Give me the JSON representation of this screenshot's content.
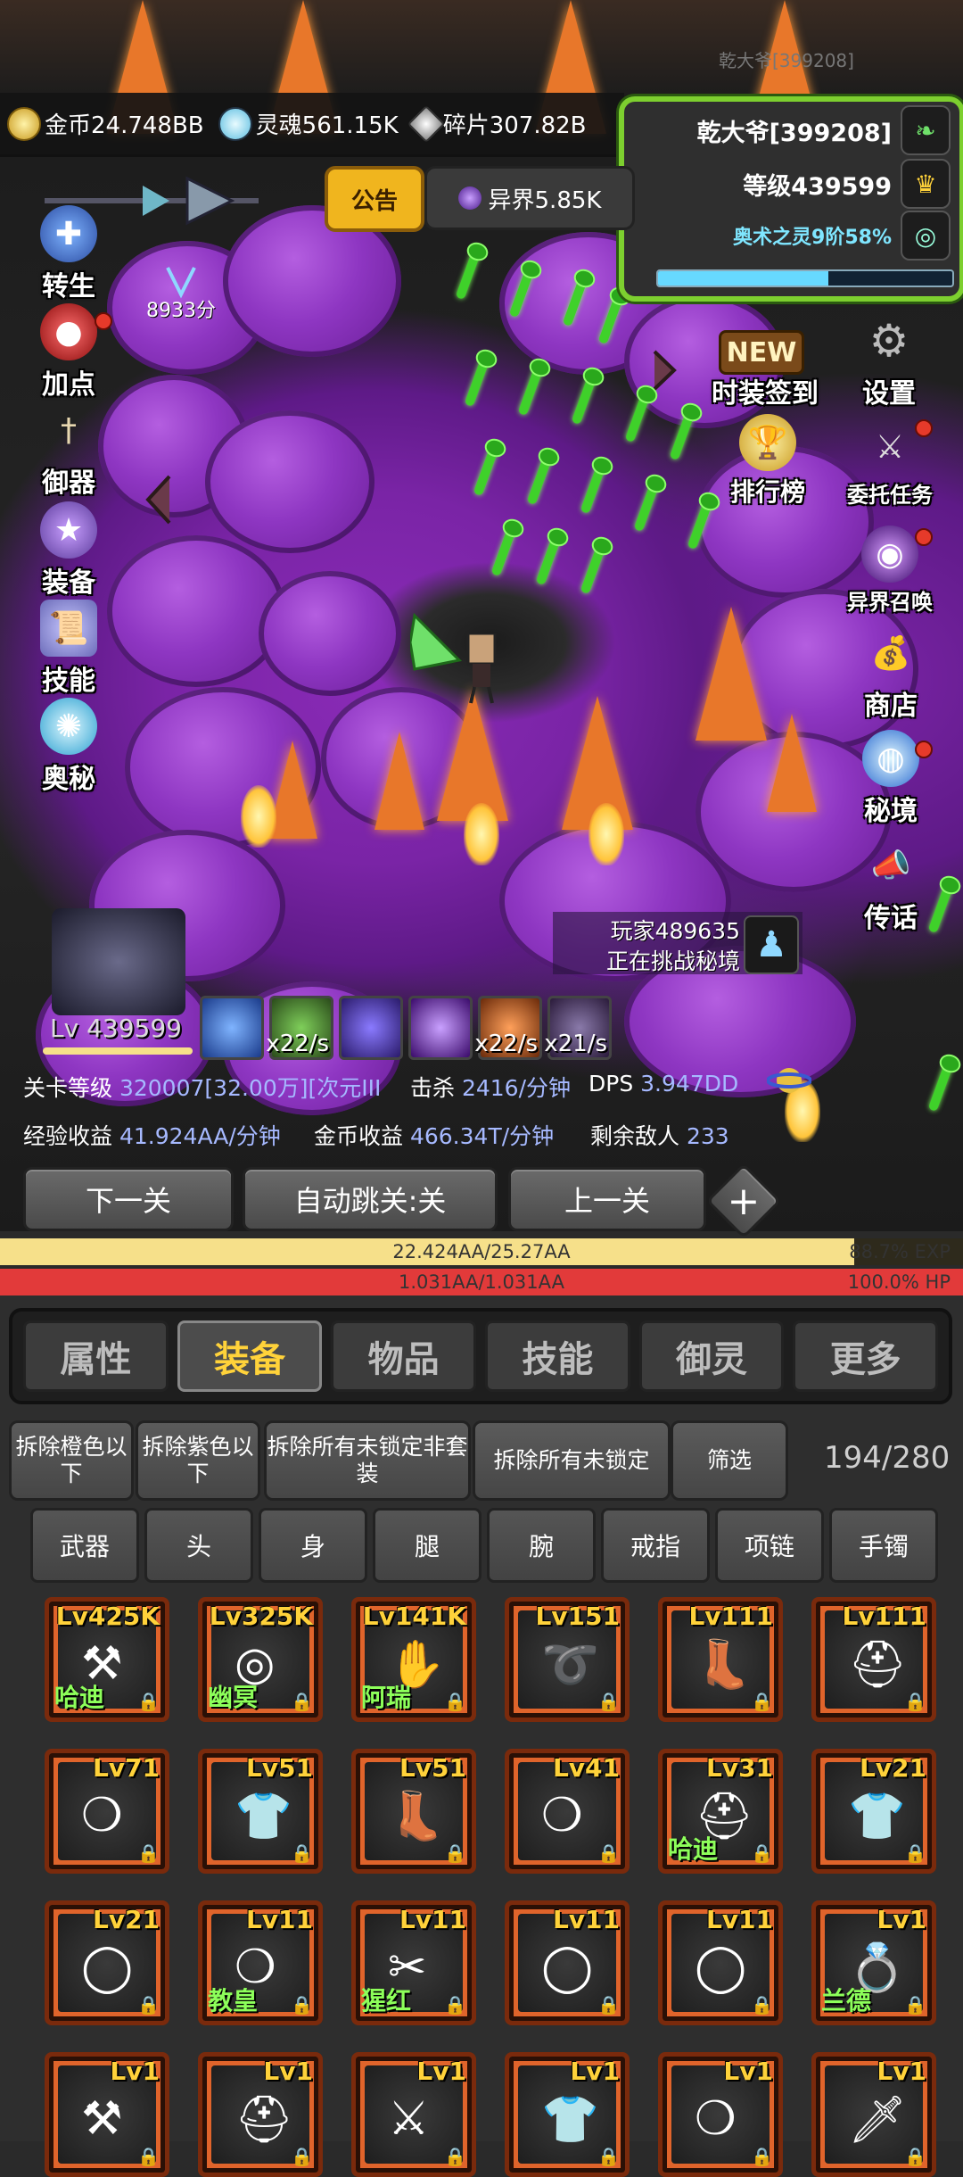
{
  "header": {
    "top_name": "乾大爷[399208]"
  },
  "resources": [
    {
      "label": "金币24.748BB",
      "icon": "gold-coin-icon",
      "color": "#e8c040"
    },
    {
      "label": "灵魂561.15K",
      "icon": "soul-icon",
      "color": "#8fd8ff"
    },
    {
      "label": "碎片307.82B",
      "icon": "shard-icon",
      "color": "#cfcfcf"
    }
  ],
  "player": {
    "name": "乾大爷[399208]",
    "level": "等级439599",
    "arcane": "奥术之灵9阶58%",
    "arcane_progress": 0.58
  },
  "notice": "公告",
  "otherworld": "异界5.85K",
  "score": "8933分",
  "left_menu": [
    "转生",
    "加点",
    "御器",
    "装备",
    "技能",
    "奥秘"
  ],
  "right_menu": {
    "fashion": "时装签到",
    "fashion_badge": "NEW",
    "settings": "设置",
    "ranking": "排行榜",
    "commission": "委托任务",
    "summon": "异界召唤",
    "shop": "商店",
    "secret": "秘境",
    "teleport": "传话"
  },
  "other_player": {
    "line1": "玩家489635",
    "line2": "正在挑战秘境"
  },
  "hero_level": "Lv 439599",
  "skills": [
    {
      "label": "",
      "color": "#2a5ad0"
    },
    {
      "label": "x22/s",
      "color": "#3d6b2a"
    },
    {
      "label": "",
      "color": "#4b2aa8"
    },
    {
      "label": "",
      "color": "#6a2ab8"
    },
    {
      "label": "x22/s",
      "color": "#c0581e"
    },
    {
      "label": "x21/s",
      "color": "#4a3a6a"
    }
  ],
  "stats": {
    "stage_label": "关卡等级",
    "stage_value": "320007[32.00万][次元III",
    "kill_label": "击杀",
    "kill_value": "2416/分钟",
    "dps_label": "DPS",
    "dps_value": "3.947DD",
    "exp_label": "经验收益",
    "exp_value": "41.924AA/分钟",
    "gold_label": "金币收益",
    "gold_value": "466.34T/分钟",
    "enemy_label": "剩余敌人",
    "enemy_value": "233"
  },
  "buttons": {
    "next": "下一关",
    "auto": "自动跳关:关",
    "prev": "上一关",
    "plus": "+"
  },
  "exp_bar": {
    "text": "22.424AA/25.27AA",
    "pct": "88.7% EXP",
    "fraction": 0.887
  },
  "hp_bar": {
    "text": "1.031AA/1.031AA",
    "pct": "100.0% HP",
    "fraction": 1.0
  },
  "tabs": [
    "属性",
    "装备",
    "物品",
    "技能",
    "御灵",
    "更多"
  ],
  "actions": [
    "拆除橙色以下",
    "拆除紫色以下",
    "拆除所有未锁定非套装",
    "拆除所有未锁定",
    "筛选"
  ],
  "inventory_count": "194/280",
  "categories": [
    "武器",
    "头",
    "身",
    "腿",
    "腕",
    "戒指",
    "项链",
    "手镯"
  ],
  "items": [
    {
      "lv": "Lv425K",
      "name": "哈迪",
      "glyph": "⚒"
    },
    {
      "lv": "Lv325K",
      "name": "幽冥",
      "glyph": "◎"
    },
    {
      "lv": "Lv141K",
      "name": "阿瑞",
      "glyph": "✋"
    },
    {
      "lv": "Lv151",
      "name": "",
      "glyph": "➰"
    },
    {
      "lv": "Lv111",
      "name": "",
      "glyph": "👢"
    },
    {
      "lv": "Lv111",
      "name": "",
      "glyph": "⛑"
    },
    {
      "lv": "Lv71",
      "name": "",
      "glyph": "❍"
    },
    {
      "lv": "Lv51",
      "name": "",
      "glyph": "👕"
    },
    {
      "lv": "Lv51",
      "name": "",
      "glyph": "👢"
    },
    {
      "lv": "Lv41",
      "name": "",
      "glyph": "❍"
    },
    {
      "lv": "Lv31",
      "name": "哈迪",
      "glyph": "⛑"
    },
    {
      "lv": "Lv21",
      "name": "",
      "glyph": "👕"
    },
    {
      "lv": "Lv21",
      "name": "",
      "glyph": "◯"
    },
    {
      "lv": "Lv11",
      "name": "教皇",
      "glyph": "❍"
    },
    {
      "lv": "Lv11",
      "name": "猩红",
      "glyph": "✂"
    },
    {
      "lv": "Lv11",
      "name": "",
      "glyph": "◯"
    },
    {
      "lv": "Lv11",
      "name": "",
      "glyph": "◯"
    },
    {
      "lv": "Lv1",
      "name": "兰德",
      "glyph": "💍"
    },
    {
      "lv": "Lv1",
      "name": "",
      "glyph": "⚒"
    },
    {
      "lv": "Lv1",
      "name": "",
      "glyph": "⛑"
    },
    {
      "lv": "Lv1",
      "name": "",
      "glyph": "⚔"
    },
    {
      "lv": "Lv1",
      "name": "",
      "glyph": "👕"
    },
    {
      "lv": "Lv1",
      "name": "",
      "glyph": "❍"
    },
    {
      "lv": "Lv1",
      "name": "",
      "glyph": "🗡"
    }
  ]
}
